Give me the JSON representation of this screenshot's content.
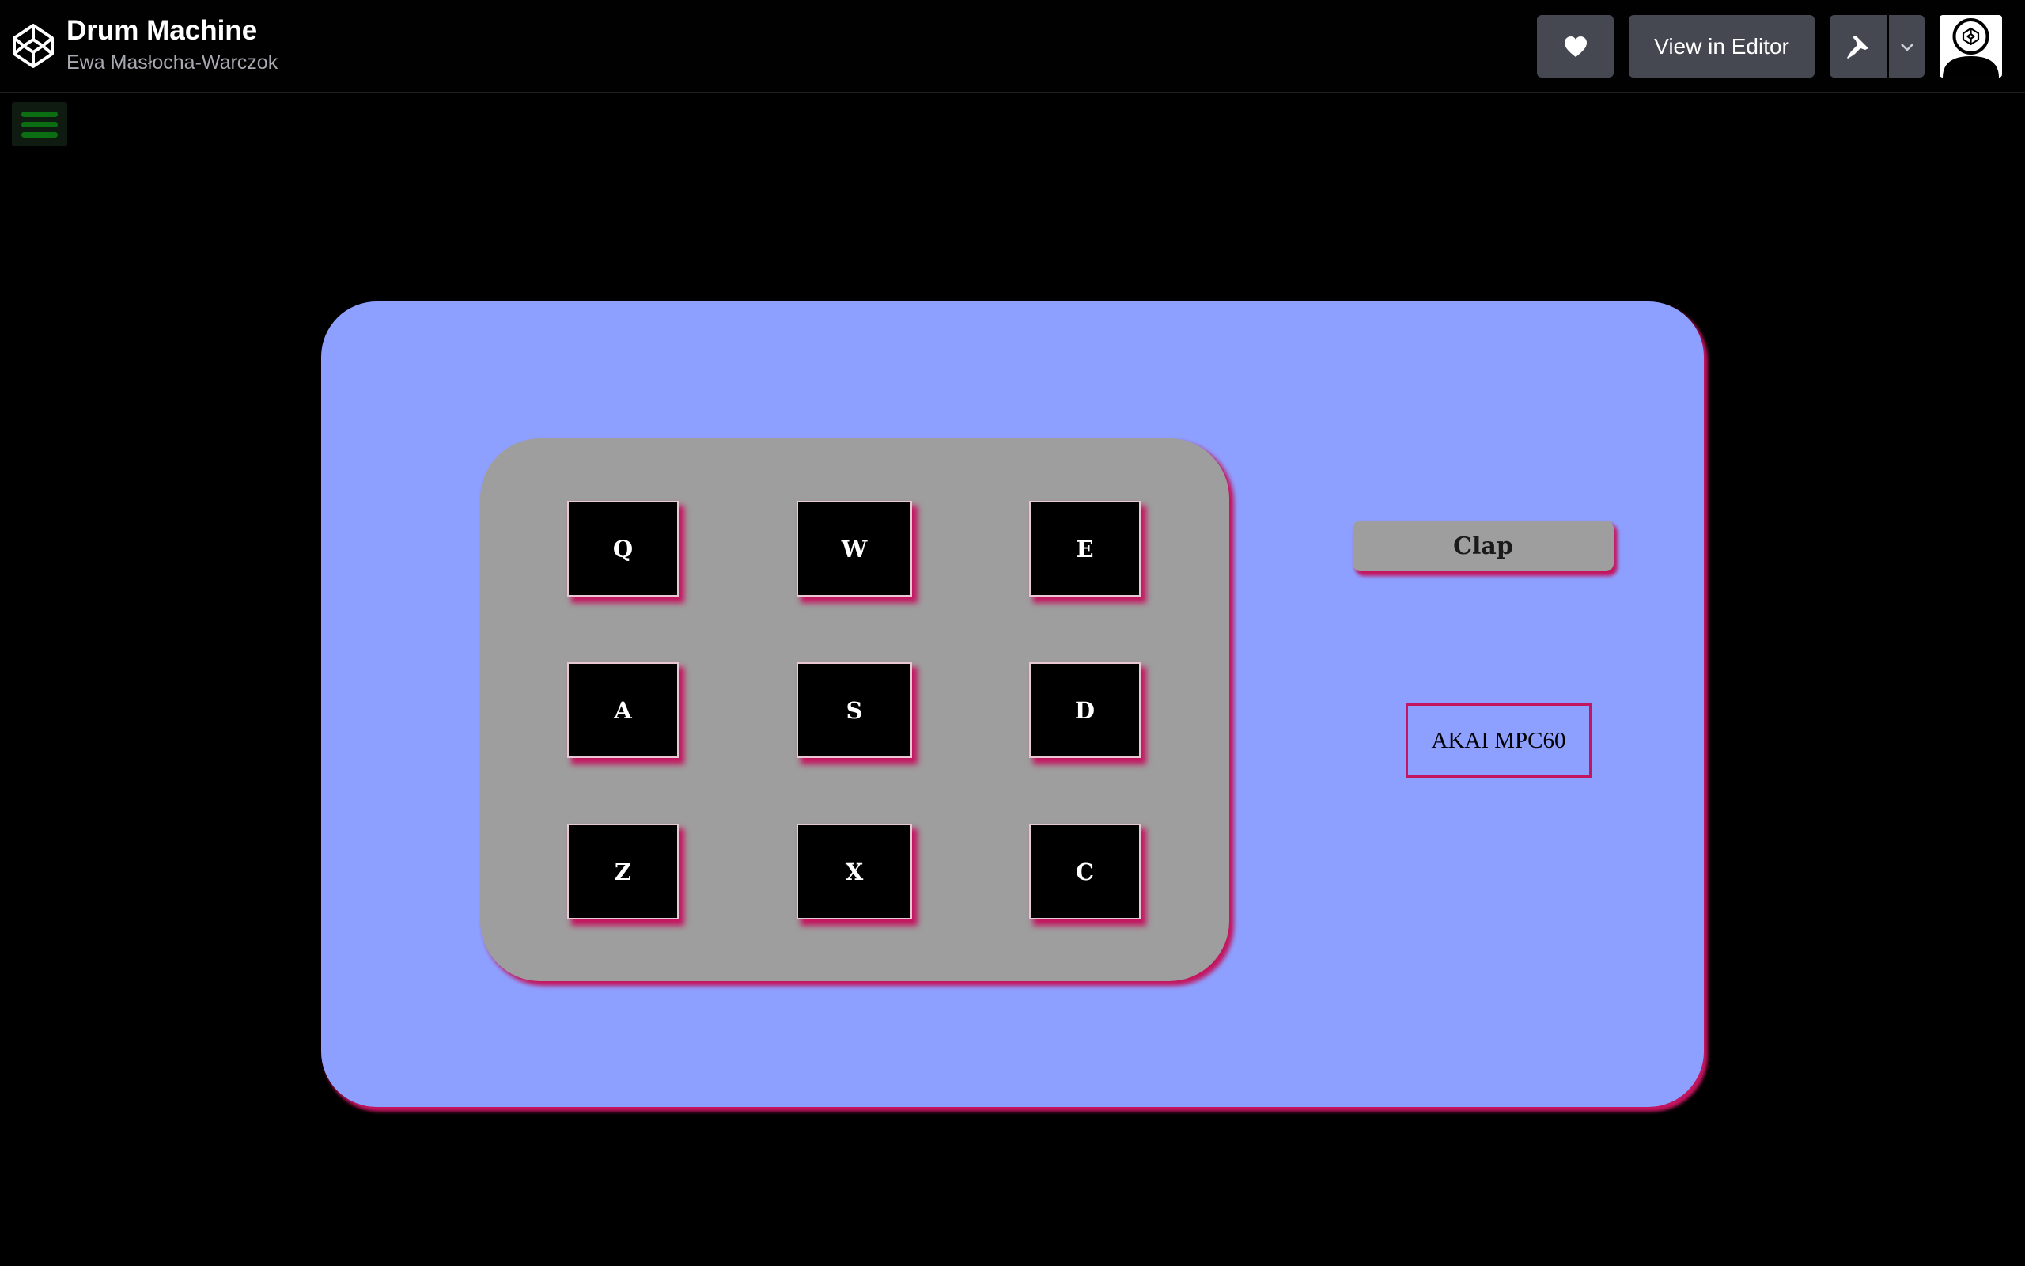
{
  "header": {
    "title": "Drum Machine",
    "author": "Ewa Masłocha-Warczok",
    "logo_icon": "codepen-logo-icon",
    "heart_icon": "heart-icon",
    "view_in_editor_label": "View in Editor",
    "pin_icon": "pin-icon",
    "caret_icon": "chevron-down-icon",
    "avatar_icon": "user-avatar-icon"
  },
  "menu": {
    "icon": "hamburger-menu-icon"
  },
  "drum_machine": {
    "pads": [
      {
        "key": "Q"
      },
      {
        "key": "W"
      },
      {
        "key": "E"
      },
      {
        "key": "A"
      },
      {
        "key": "S"
      },
      {
        "key": "D"
      },
      {
        "key": "Z"
      },
      {
        "key": "X"
      },
      {
        "key": "C"
      }
    ],
    "display_text": "Clap",
    "brand_label": "AKAI MPC60"
  },
  "colors": {
    "page_background": "#000000",
    "machine_background": "#8ea0ff",
    "pad_bank_background": "#9e9e9e",
    "accent_shadow": "#c4155f",
    "pad_background": "#000000",
    "menu_icon": "#0c6e12"
  }
}
